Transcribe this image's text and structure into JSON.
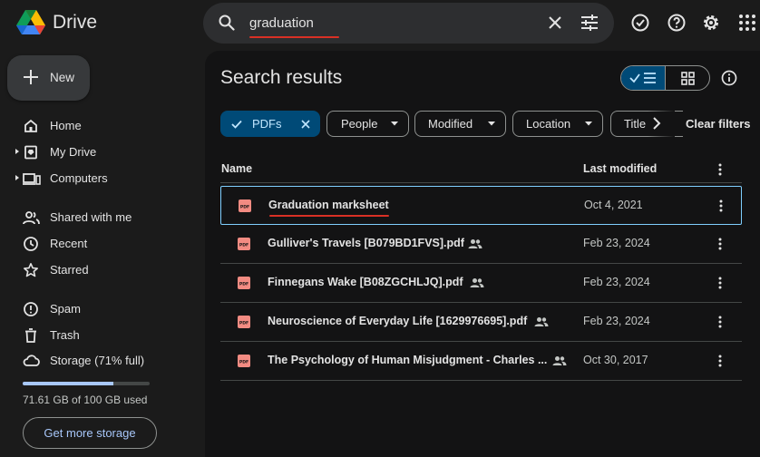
{
  "app": {
    "brand": "Drive"
  },
  "search": {
    "query": "graduation"
  },
  "sidebar": {
    "new_label": "New",
    "items": [
      {
        "label": "Home",
        "icon": "home-icon"
      },
      {
        "label": "My Drive",
        "icon": "my-drive-icon"
      },
      {
        "label": "Computers",
        "icon": "computers-icon"
      },
      {
        "label": "Shared with me",
        "icon": "shared-with-me-icon"
      },
      {
        "label": "Recent",
        "icon": "clock-icon"
      },
      {
        "label": "Starred",
        "icon": "star-icon"
      },
      {
        "label": "Spam",
        "icon": "spam-icon"
      },
      {
        "label": "Trash",
        "icon": "trash-icon"
      },
      {
        "label": "Storage (71% full)",
        "icon": "cloud-icon"
      }
    ],
    "storage": {
      "used_fraction": 0.7161,
      "used_text": "71.61 GB of 100 GB used",
      "button": "Get more storage"
    }
  },
  "main": {
    "title": "Search results",
    "filters": {
      "chips": [
        {
          "label": "PDFs",
          "selected": true
        },
        {
          "label": "People",
          "selected": false
        },
        {
          "label": "Modified",
          "selected": false
        },
        {
          "label": "Location",
          "selected": false
        },
        {
          "label": "Title",
          "selected": false
        }
      ],
      "clear": "Clear filters"
    },
    "columns": {
      "name": "Name",
      "modified": "Last modified"
    },
    "files": [
      {
        "name": "Graduation marksheet",
        "modified": "Oct 4, 2021",
        "shared": false
      },
      {
        "name": "Gulliver's Travels [B079BD1FVS].pdf",
        "modified": "Feb 23, 2024",
        "shared": true
      },
      {
        "name": "Finnegans Wake [B08ZGCHLJQ].pdf",
        "modified": "Feb 23, 2024",
        "shared": true
      },
      {
        "name": "Neuroscience of Everyday Life [1629976695].pdf",
        "modified": "Feb 23, 2024",
        "shared": true
      },
      {
        "name": "The Psychology of Human Misjudgment - Charles ...",
        "modified": "Oct 30, 2017",
        "shared": true
      }
    ]
  },
  "colors": {
    "accent": "#a8c7fa",
    "selected_chip": "#004a77",
    "annotation": "#d93025",
    "pdf": "#f28b82"
  }
}
